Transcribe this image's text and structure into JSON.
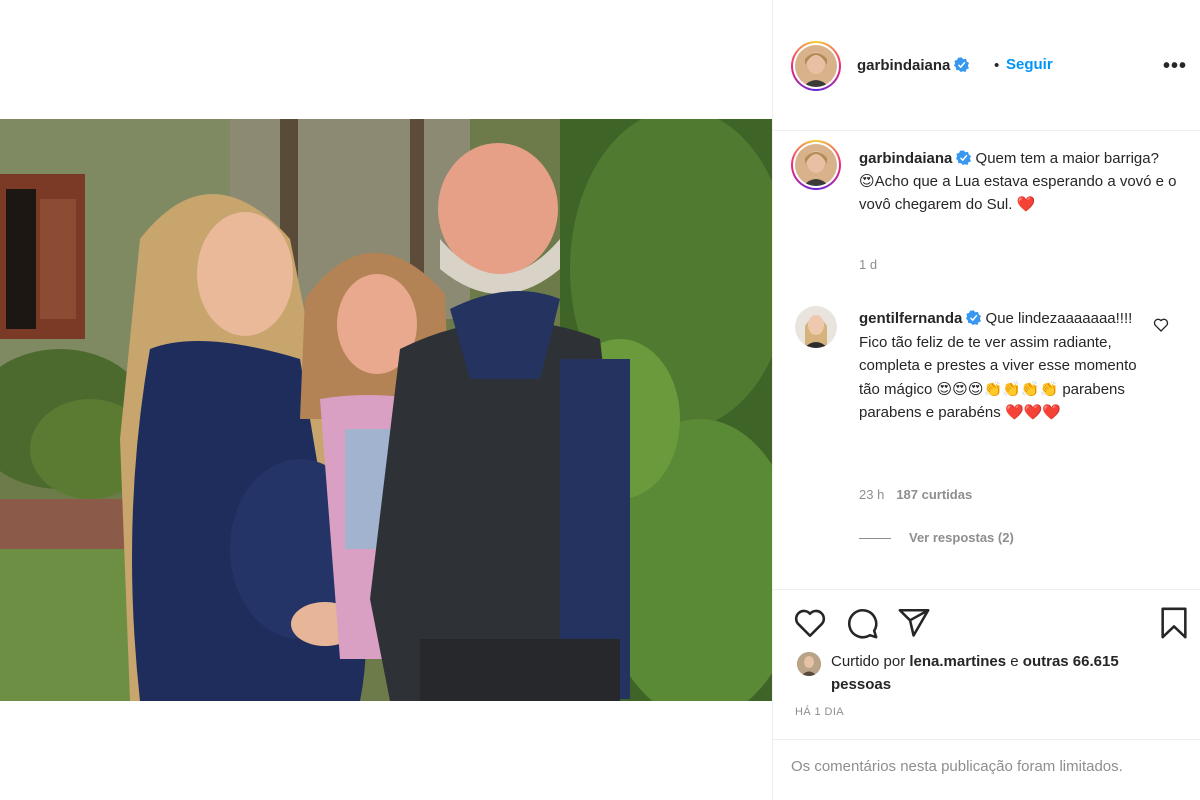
{
  "post": {
    "author": "garbindaiana",
    "verified": true,
    "separator": "•",
    "follow_label": "Seguir",
    "more_icon": "more-horizontal-icon",
    "more_label": "•••"
  },
  "caption": {
    "author": "garbindaiana",
    "text": " Quem tem a maior barriga? 😍Acho que a Lua estava esperando a vovó e o vovô chegarem do Sul. ❤️",
    "time": "1 d"
  },
  "comment": {
    "author": "gentilfernanda",
    "verified": true,
    "text": " Que lindezaaaaaaa!!!! Fico tão feliz de te ver assim radiante, completa e prestes a viver esse momento tão mágico 😍😍😍👏👏👏👏 parabens parabens e parabéns ❤️❤️❤️",
    "time": "23 h",
    "likes": "187 curtidas",
    "replies_label": "Ver respostas (2)"
  },
  "actions": {
    "like_icon": "heart-icon",
    "comment_icon": "comment-icon",
    "share_icon": "send-icon",
    "save_icon": "bookmark-icon"
  },
  "likes": {
    "prefix": "Curtido por ",
    "user": "lena.martines",
    "middle": " e ",
    "others": "outras 66.615 pessoas"
  },
  "posted_ago": "HÁ 1 DIA",
  "comments_limited": "Os comentários nesta publicação foram limitados.",
  "colors": {
    "link_blue": "#0095f6",
    "verified_blue": "#3897f0",
    "muted_text": "#8e8e8e",
    "border": "#efefef"
  }
}
